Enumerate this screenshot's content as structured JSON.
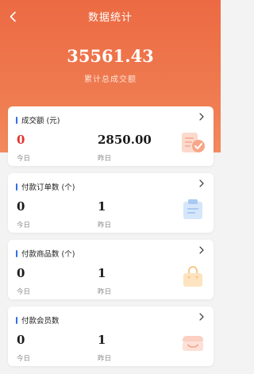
{
  "header": {
    "title": "数据统计",
    "total_value": "35561.43",
    "total_label": "累计总成交额"
  },
  "cards": [
    {
      "title": "成交额 (元)",
      "today_value": "0",
      "today_label": "今日",
      "yesterday_value": "2850.00",
      "yesterday_label": "昨日",
      "icon": "document-check-icon",
      "accent": "#e0342e"
    },
    {
      "title": "付款订单数 (个)",
      "today_value": "0",
      "today_label": "今日",
      "yesterday_value": "1",
      "yesterday_label": "昨日",
      "icon": "clipboard-icon"
    },
    {
      "title": "付款商品数 (个)",
      "today_value": "0",
      "today_label": "今日",
      "yesterday_value": "1",
      "yesterday_label": "昨日",
      "icon": "shopping-bag-icon"
    },
    {
      "title": "付款会员数",
      "today_value": "0",
      "today_label": "今日",
      "yesterday_value": "1",
      "yesterday_label": "昨日",
      "icon": "member-icon"
    }
  ],
  "colors": {
    "header_orange": "#ec6a43",
    "marker_blue": "#2f6fe4",
    "highlight_red": "#e0342e"
  }
}
